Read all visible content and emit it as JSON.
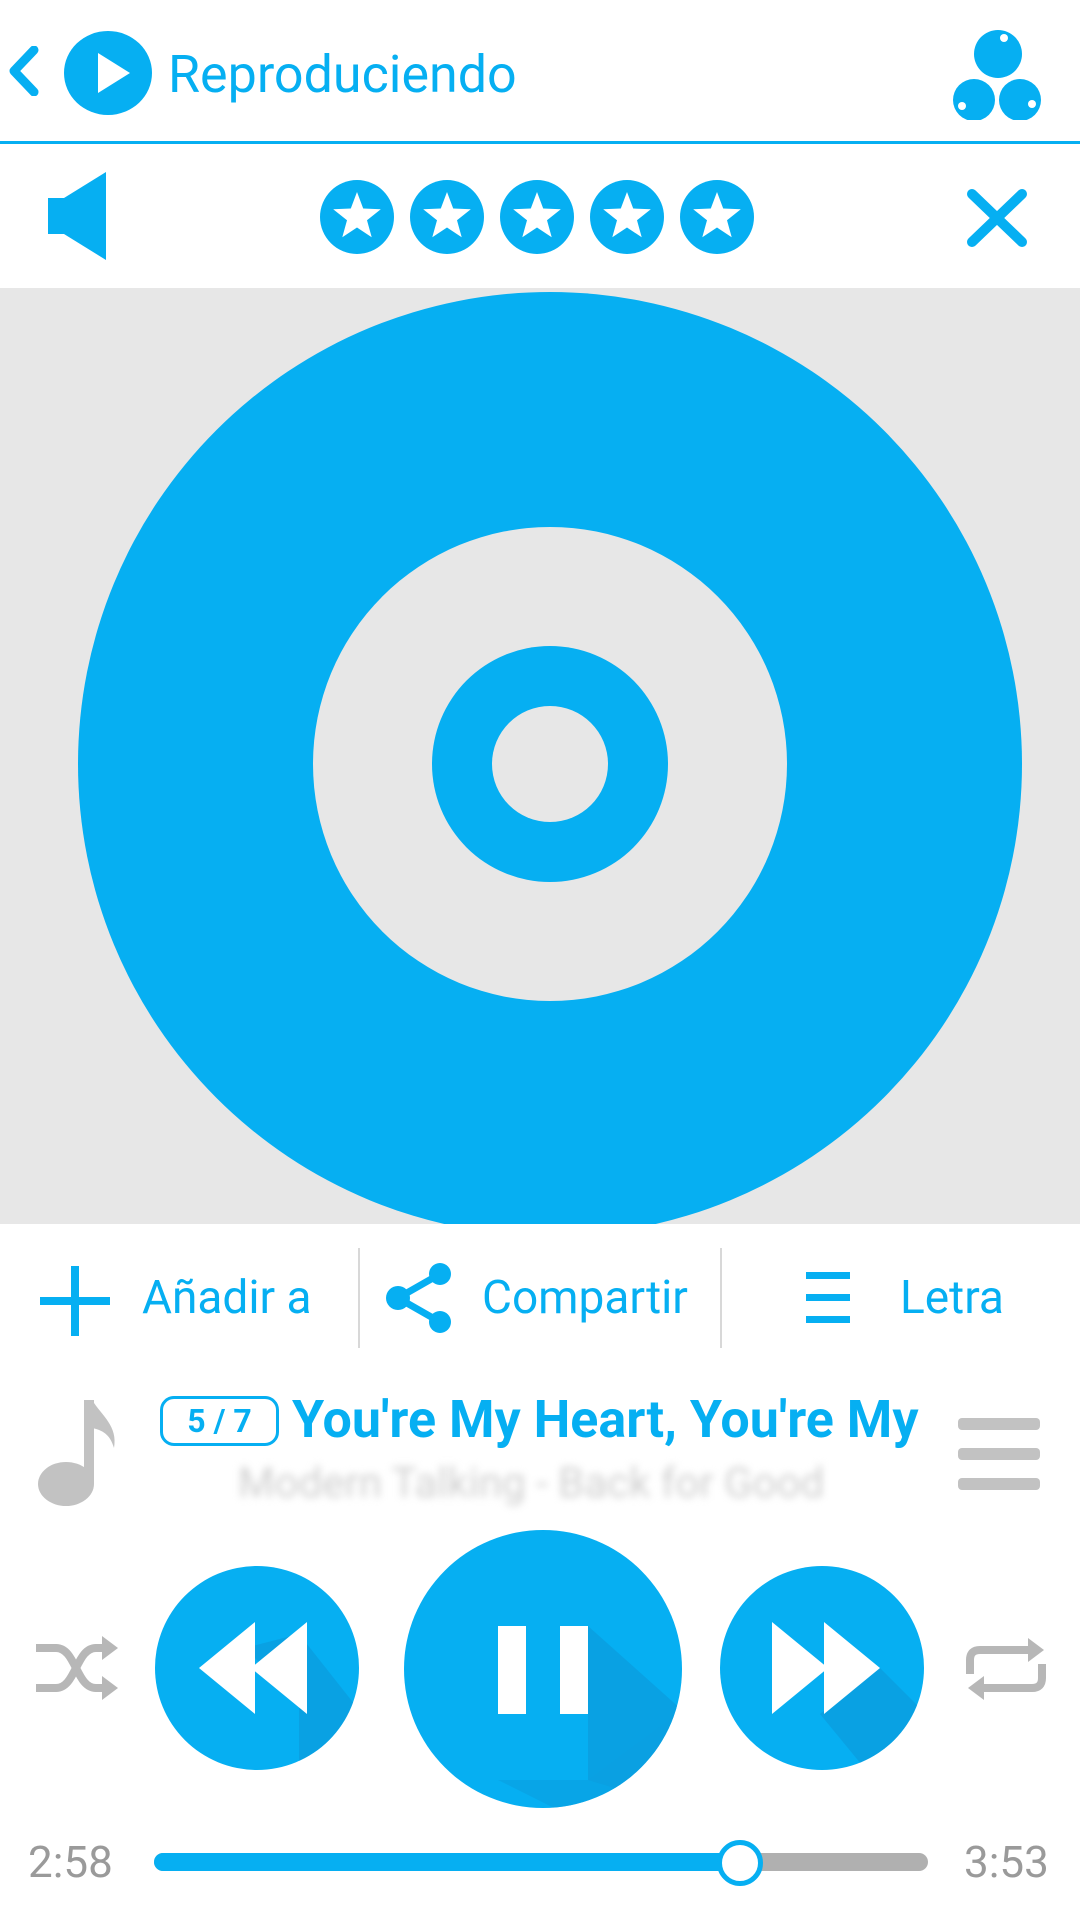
{
  "header": {
    "title": "Reproduciendo",
    "back_icon": "chevron-left-icon",
    "app_icon": "play-circle-icon",
    "menu_icon": "three-dots-triangle-icon"
  },
  "rating": {
    "stars": 5,
    "volume_icon": "speaker-icon",
    "close_icon": "close-icon"
  },
  "album_art": {
    "placeholder_icon": "disc-icon"
  },
  "actions": {
    "add_label": "Añadir a",
    "share_label": "Compartir",
    "lyrics_label": "Letra"
  },
  "track": {
    "position": "5 / 7",
    "title": "You're My Heart, You're My Soul",
    "subtitle": "Modern Talking - Back for Good"
  },
  "progress": {
    "elapsed": "2:58",
    "total": "3:53",
    "fraction": 0.757
  },
  "colors": {
    "accent": "#06aff2",
    "art_background": "#e7e7e7",
    "muted": "#c2c2c2"
  }
}
